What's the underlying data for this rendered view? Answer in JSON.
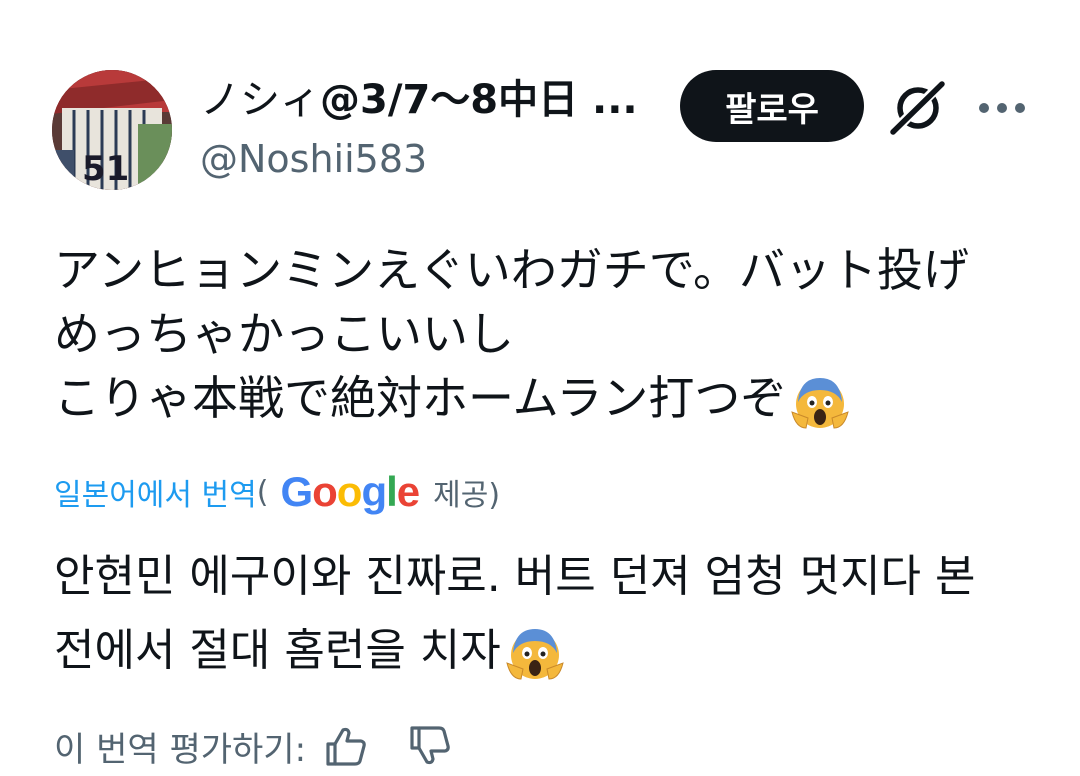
{
  "author": {
    "avatar_icon": "avatar-baseball-player",
    "display_name_prefix": "ノシィ",
    "display_name_suffix": "@3/7〜8中日 ...",
    "handle": "@Noshii583"
  },
  "actions": {
    "follow_label": "팔로우",
    "grok_icon": "grok-slash-icon",
    "more_icon": "more-horizontal-icon"
  },
  "tweet": {
    "lines": [
      "アンヒョンミンえぐいわガチで。バット投げ",
      "めっちゃかっこいいし",
      "こりゃ本戦で絶対ホームラン打つぞ"
    ],
    "emoji": "😱"
  },
  "translation_credit": {
    "link_text": "일본어에서 번역",
    "open_paren": "(",
    "provider": "Google",
    "provided_label": "제공)"
  },
  "translation": {
    "lines": [
      "안현민 에구이와 진짜로. 버트 던져 엄청 멋지다 본",
      "전에서 절대 홈런을 치자"
    ],
    "emoji": "😱"
  },
  "rating": {
    "label": "이 번역 평가하기:",
    "thumbs_up_icon": "thumbs-up-icon",
    "thumbs_down_icon": "thumbs-down-icon"
  },
  "colors": {
    "text_primary": "#0f1419",
    "text_secondary": "#536471",
    "link": "#1d9bf0",
    "follow_bg": "#0f1419"
  }
}
